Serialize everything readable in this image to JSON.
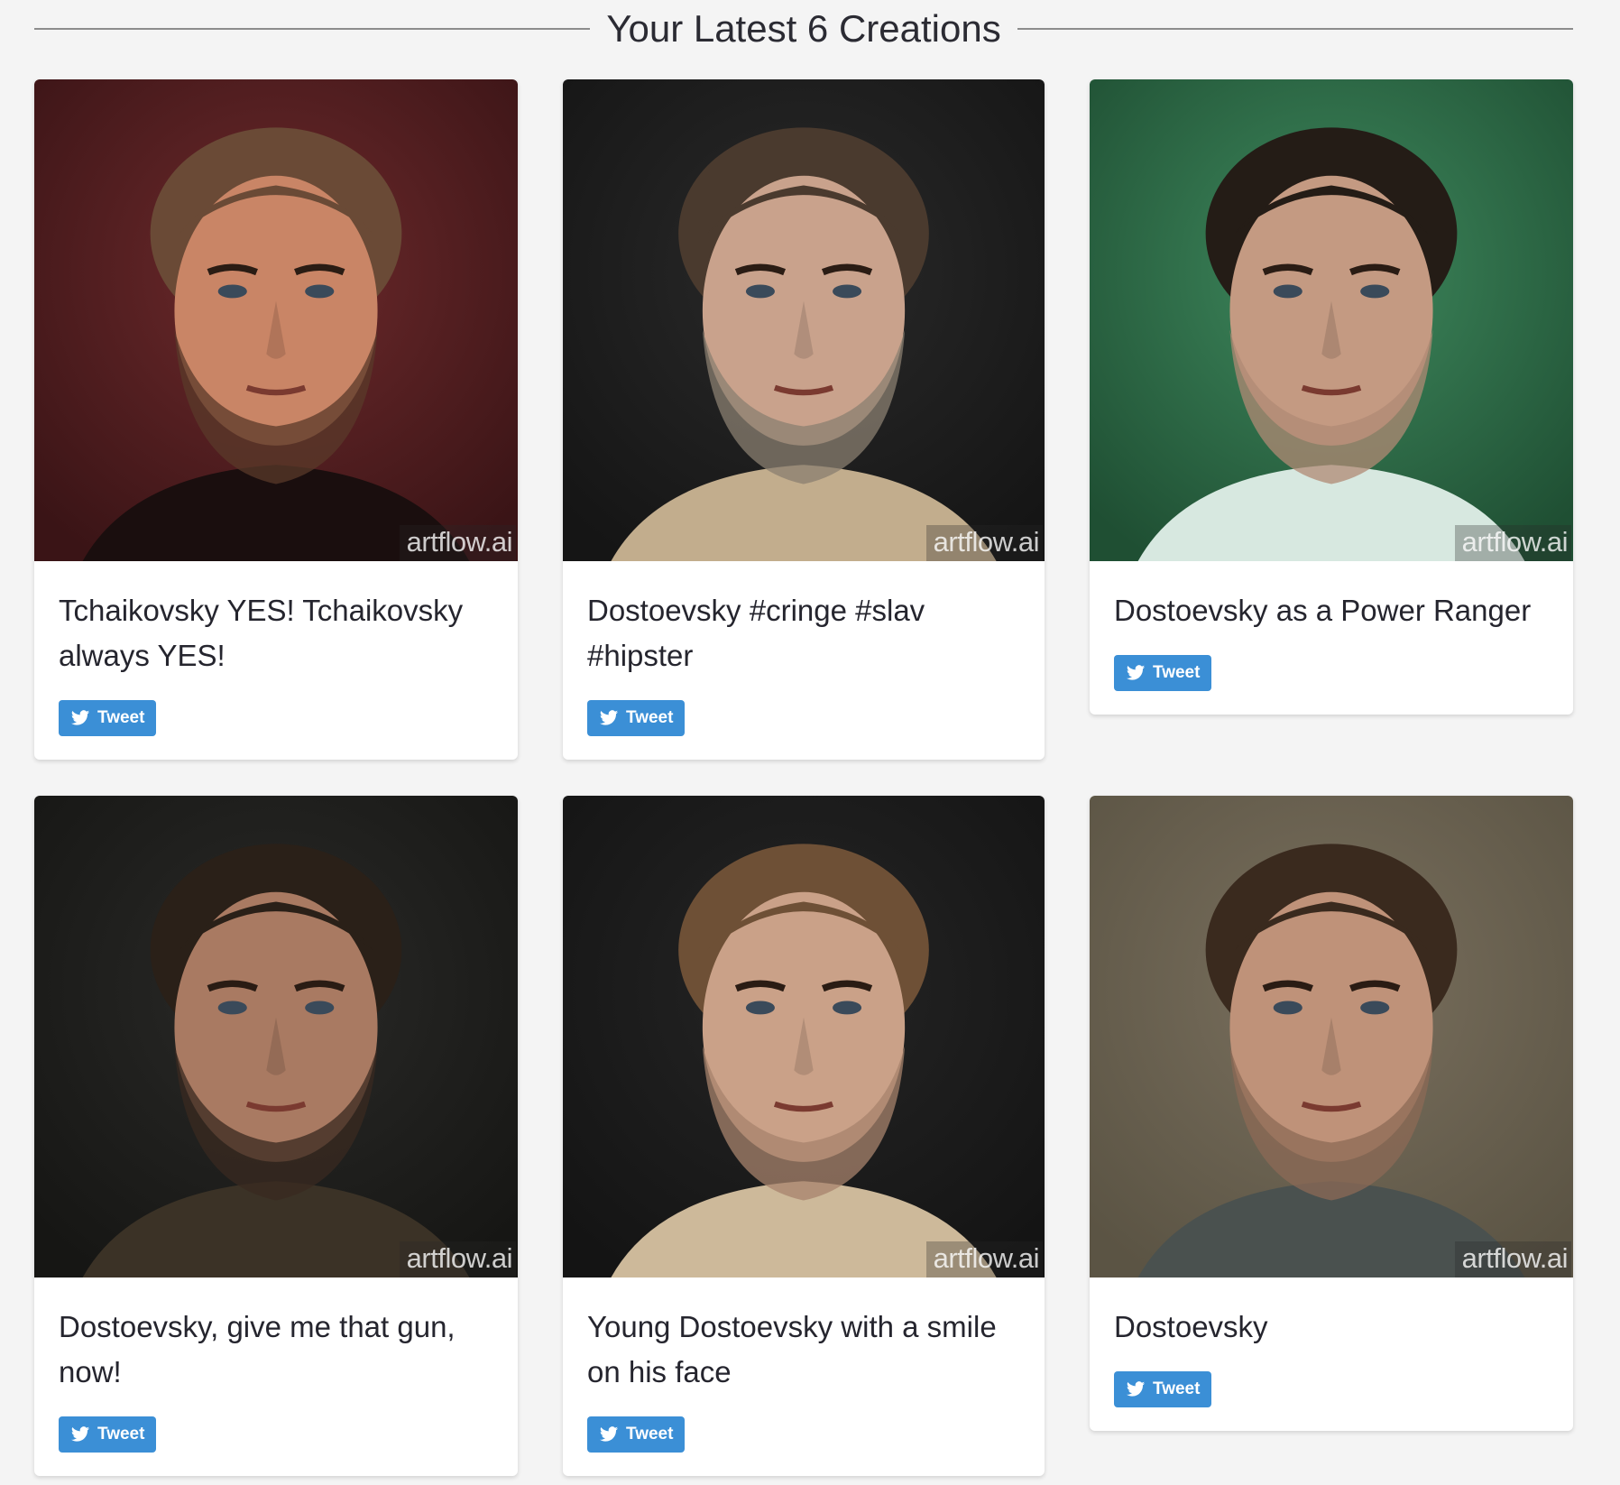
{
  "header": {
    "title": "Your Latest 6 Creations"
  },
  "watermark": "artflow.ai",
  "tweet_label": "Tweet",
  "cards": [
    {
      "title": "Tchaikovsky YES! Tchaikovsky always YES!",
      "image": {
        "bg": "#6e2a2c",
        "bg2": "#3a1416",
        "skin": "#c98566",
        "hair": "#6a4a36",
        "beard": "#5a3a2a",
        "collar": "#1a0e0e"
      }
    },
    {
      "title": "Dostoevsky #cringe #slav #hipster",
      "image": {
        "bg": "#2a2a2a",
        "bg2": "#151515",
        "skin": "#c9a28c",
        "hair": "#4a3a2e",
        "beard": "#8a7f70",
        "collar": "#c2ad8d"
      }
    },
    {
      "title": "Dostoevsky as a Power Ranger",
      "image": {
        "bg": "#3f8a5e",
        "bg2": "#1f4f33",
        "skin": "#c49a82",
        "hair": "#241c16",
        "beard": "#b08a74",
        "collar": "#d7e8e0"
      }
    },
    {
      "title": "Dostoevsky, give me that gun, now!",
      "image": {
        "bg": "#2a2a28",
        "bg2": "#161614",
        "skin": "#a97a62",
        "hair": "#2a2018",
        "beard": "#3a2a20",
        "collar": "#3b3226"
      }
    },
    {
      "title": "Young Dostoevsky with a smile on his face",
      "image": {
        "bg": "#252525",
        "bg2": "#141414",
        "skin": "#caa188",
        "hair": "#6e5036",
        "beard": "#a7836c",
        "collar": "#cdb99a"
      }
    },
    {
      "title": "Dostoevsky",
      "image": {
        "bg": "#7a705e",
        "bg2": "#5b5444",
        "skin": "#bf9279",
        "hair": "#3a2a1e",
        "beard": "#8c6a56",
        "collar": "#4a514f"
      }
    }
  ]
}
